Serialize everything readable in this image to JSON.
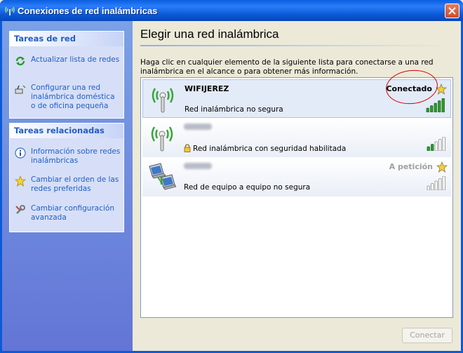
{
  "window": {
    "title": "Conexiones de red inalámbricas"
  },
  "sidebar": {
    "network_tasks": {
      "header": "Tareas de red",
      "items": [
        {
          "label": "Actualizar lista de redes",
          "icon": "refresh-icon"
        },
        {
          "label": "Configurar una red inalámbrica doméstica o de oficina pequeña",
          "icon": "wireless-setup-icon"
        }
      ]
    },
    "related_tasks": {
      "header": "Tareas relacionadas",
      "items": [
        {
          "label": "Información sobre redes inalámbricas",
          "icon": "info-icon"
        },
        {
          "label": "Cambiar el orden de las redes preferidas",
          "icon": "star-icon"
        },
        {
          "label": "Cambiar configuración avanzada",
          "icon": "tools-icon"
        }
      ]
    }
  },
  "main": {
    "title": "Elegir una red inalámbrica",
    "instructions": "Haga clic en cualquier elemento de la siguiente lista para conectarse a una red inalámbrica en el alcance o para obtener más información.",
    "networks": [
      {
        "name": "WIFIJEREZ",
        "status": "Conectado",
        "description": "Red inalámbrica no segura",
        "signal_bars": 5,
        "secured": false
      },
      {
        "name": "",
        "status": "",
        "description": "Red inalámbrica con seguridad habilitada",
        "signal_bars": 2,
        "secured": true
      },
      {
        "name": "",
        "status": "A petición",
        "description": "Red de equipo a equipo no segura",
        "signal_bars": 0,
        "secured": false
      }
    ],
    "connect_label": "Conectar"
  },
  "colors": {
    "title_bar": "#0a5fe0",
    "task_link": "#215dc6",
    "signal_on": "#2f9a2f",
    "annotation": "#d00000"
  }
}
